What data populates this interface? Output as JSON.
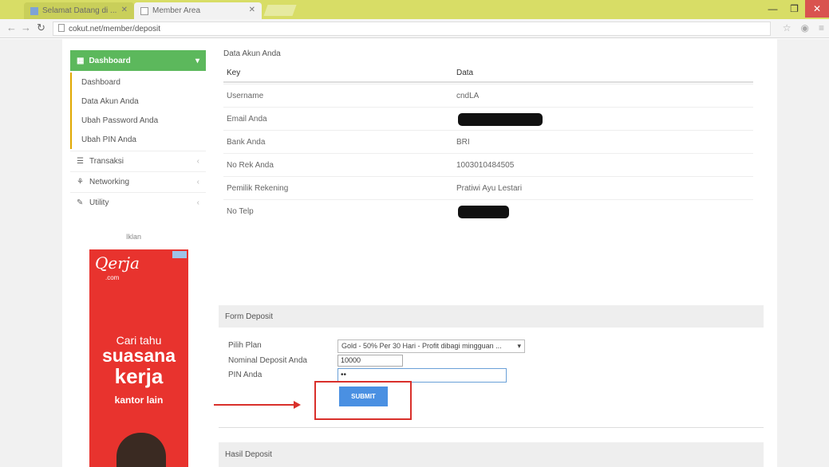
{
  "browser": {
    "tabs": [
      {
        "label": "Selamat Datang di ..."
      },
      {
        "label": "Member Area"
      }
    ],
    "url": "cokut.net/member/deposit"
  },
  "sidebar": {
    "active": {
      "icon": "dashboard-icon",
      "label": "Dashboard"
    },
    "subitems": [
      "Dashboard",
      "Data Akun Anda",
      "Ubah Password Anda",
      "Ubah PIN Anda"
    ],
    "items": [
      {
        "icon": "list-icon",
        "label": "Transaksi"
      },
      {
        "icon": "network-icon",
        "label": "Networking"
      },
      {
        "icon": "wrench-icon",
        "label": "Utility"
      }
    ]
  },
  "ad": {
    "label": "Iklan",
    "brand": "Qerja",
    "brand_sub": ".com",
    "lines": [
      "Cari tahu",
      "suasana",
      "kerja",
      "kantor lain"
    ]
  },
  "account": {
    "title": "Data Akun Anda",
    "col_key": "Key",
    "col_data": "Data",
    "rows": [
      {
        "key": "Username",
        "value": "cndLA"
      },
      {
        "key": "Email Anda",
        "value": ""
      },
      {
        "key": "Bank Anda",
        "value": "BRI"
      },
      {
        "key": "No Rek Anda",
        "value": "1003010484505"
      },
      {
        "key": "Pemilik Rekening",
        "value": "Pratiwi Ayu Lestari"
      },
      {
        "key": "No Telp",
        "value": ""
      }
    ]
  },
  "deposit": {
    "title": "Form Deposit",
    "label_plan": "Pilih Plan",
    "plan_value": "Gold - 50% Per 30 Hari - Profit dibagi mingguan ...",
    "label_amount": "Nominal Deposit Anda",
    "amount_value": "10000",
    "label_pin": "PIN Anda",
    "pin_value": "••",
    "submit_label": "SUBMIT"
  },
  "footer_panel": {
    "title": "Hasil Deposit"
  },
  "colors": {
    "success": "#5cb85c",
    "primary": "#4a90e2",
    "annotation": "#d9302b"
  }
}
